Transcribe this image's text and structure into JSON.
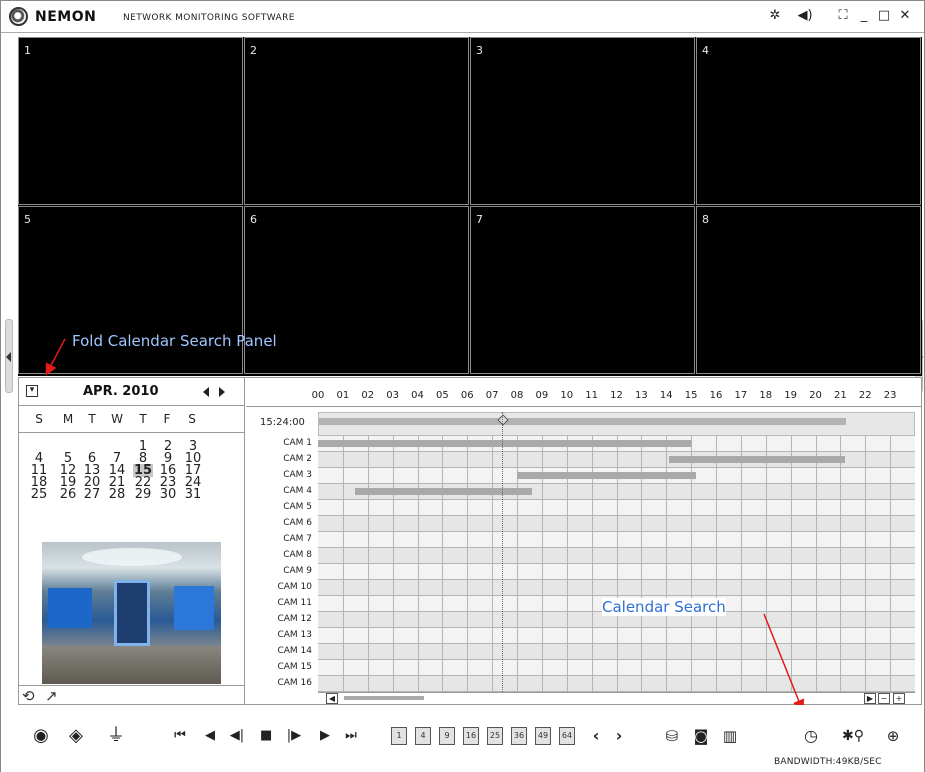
{
  "app": {
    "title": "NEMON",
    "subtitle": "NETWORK MONITORING SOFTWARE",
    "icons": [
      "settings-icon",
      "volume-icon",
      "fullscreen-icon",
      "minimize-icon",
      "maximize-icon",
      "close-icon"
    ]
  },
  "channels": [
    "1",
    "2",
    "3",
    "4",
    "5",
    "6",
    "7",
    "8"
  ],
  "annotations": {
    "fold_calendar": "Fold Calendar Search Panel",
    "calendar_search": "Calendar Search"
  },
  "calendar": {
    "month": "APR. 2010",
    "weekdays": [
      "S",
      "M",
      "T",
      "W",
      "T",
      "F",
      "S"
    ],
    "days": [
      "1",
      "2",
      "3",
      "4",
      "5",
      "6",
      "7",
      "8",
      "9",
      "10",
      "11",
      "12",
      "13",
      "14",
      "15",
      "16",
      "17",
      "18",
      "19",
      "20",
      "21",
      "22",
      "23",
      "24",
      "25",
      "26",
      "27",
      "28",
      "29",
      "30",
      "31"
    ],
    "selected_day": "15"
  },
  "timeline": {
    "hours": [
      "00",
      "01",
      "02",
      "03",
      "04",
      "05",
      "06",
      "07",
      "08",
      "09",
      "10",
      "11",
      "12",
      "13",
      "14",
      "15",
      "16",
      "17",
      "18",
      "19",
      "20",
      "21",
      "22",
      "23"
    ],
    "current_time": "15:24:00",
    "cameras": [
      "CAM 1",
      "CAM 2",
      "CAM 3",
      "CAM 4",
      "CAM 5",
      "CAM 6",
      "CAM 7",
      "CAM 8",
      "CAM 9",
      "CAM 10",
      "CAM 11",
      "CAM 12",
      "CAM 13",
      "CAM 14",
      "CAM 15",
      "CAM 16"
    ],
    "recordings": [
      {
        "camera": "CAM 1",
        "start_hour": 0.0,
        "end_hour": 15.0
      },
      {
        "camera": "CAM 2",
        "start_hour": 14.1,
        "end_hour": 21.2
      },
      {
        "camera": "CAM 3",
        "start_hour": 8.0,
        "end_hour": 15.2
      },
      {
        "camera": "CAM 4",
        "start_hour": 1.5,
        "end_hour": 8.6
      }
    ],
    "time_bar_end_hour": 21.2,
    "cursor_hour": 7.4
  },
  "toolbar": {
    "layout_labels": [
      "1",
      "4",
      "9",
      "16",
      "25",
      "36",
      "49",
      "64"
    ],
    "bandwidth": "BANDWIDTH:49KB/SEC"
  }
}
